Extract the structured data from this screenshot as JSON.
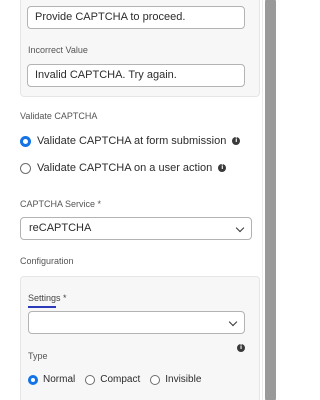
{
  "fields": {
    "required_message": "Provide CAPTCHA to proceed.",
    "incorrect_label": "Incorrect Value",
    "incorrect_message": "Invalid CAPTCHA. Try again."
  },
  "validate": {
    "label": "Validate CAPTCHA",
    "options": [
      {
        "label": "Validate CAPTCHA at form submission",
        "selected": true
      },
      {
        "label": "Validate CAPTCHA on a user action",
        "selected": false
      }
    ]
  },
  "service": {
    "label": "CAPTCHA Service *",
    "value": "reCAPTCHA"
  },
  "configuration": {
    "label": "Configuration",
    "settings_label": "Settings *",
    "settings_value": "",
    "type_label": "Type",
    "type_options": [
      {
        "label": "Normal",
        "selected": true
      },
      {
        "label": "Compact",
        "selected": false
      },
      {
        "label": "Invisible",
        "selected": false
      }
    ]
  },
  "icons": {
    "info": "info-icon",
    "chevron": "chevron-down-icon"
  },
  "colors": {
    "accent": "#1473e6",
    "settings_underline": "#2a3ab8"
  }
}
